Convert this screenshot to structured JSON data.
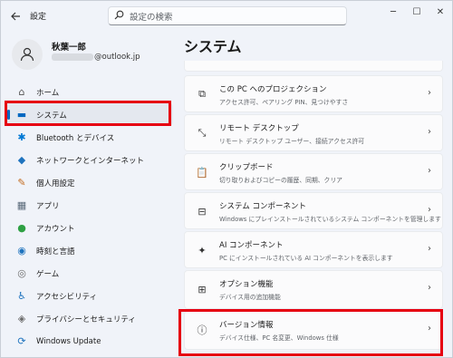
{
  "titlebar": {
    "back_icon": "back-arrow-icon",
    "app_title": "設定",
    "search_placeholder": "設定の検索",
    "minimize": "─",
    "maximize": "☐",
    "close": "✕"
  },
  "profile": {
    "name": "秋葉一郎",
    "email": "@outlook.jp"
  },
  "sidebar": {
    "items": [
      {
        "label": "ホーム",
        "icon": "home-icon",
        "glyph": "⌂",
        "color": "#555555"
      },
      {
        "label": "システム",
        "icon": "system-icon",
        "glyph": "▬",
        "color": "#0067c0"
      },
      {
        "label": "Bluetooth とデバイス",
        "icon": "bluetooth-icon",
        "glyph": "✱",
        "color": "#0078d4"
      },
      {
        "label": "ネットワークとインターネット",
        "icon": "wifi-icon",
        "glyph": "◆",
        "color": "#1e73be"
      },
      {
        "label": "個人用設定",
        "icon": "paintbrush-icon",
        "glyph": "✎",
        "color": "#c36b1e"
      },
      {
        "label": "アプリ",
        "icon": "apps-icon",
        "glyph": "▦",
        "color": "#5a6a7a"
      },
      {
        "label": "アカウント",
        "icon": "account-icon",
        "glyph": "●",
        "color": "#2ea043"
      },
      {
        "label": "時刻と言語",
        "icon": "globe-clock-icon",
        "glyph": "◉",
        "color": "#1e73be"
      },
      {
        "label": "ゲーム",
        "icon": "game-controller-icon",
        "glyph": "◎",
        "color": "#6b6b6b"
      },
      {
        "label": "アクセシビリティ",
        "icon": "accessibility-icon",
        "glyph": "♿",
        "color": "#1e73be"
      },
      {
        "label": "プライバシーとセキュリティ",
        "icon": "shield-icon",
        "glyph": "◈",
        "color": "#6b6b6b"
      },
      {
        "label": "Windows Update",
        "icon": "windows-update-icon",
        "glyph": "⟳",
        "color": "#1e73be"
      }
    ]
  },
  "main": {
    "title": "システム",
    "cards": [
      {
        "title": "この PC へのプロジェクション",
        "desc": "アクセス許可、ペアリング PIN、見つけやすさ",
        "icon": "projection-icon",
        "glyph": "⧉"
      },
      {
        "title": "リモート デスクトップ",
        "desc": "リモート デスクトップ ユーザー、接続アクセス許可",
        "icon": "remote-desktop-icon",
        "glyph": "⤡"
      },
      {
        "title": "クリップボード",
        "desc": "切り取りおよびコピーの履歴、同期、クリア",
        "icon": "clipboard-icon",
        "glyph": "📋"
      },
      {
        "title": "システム コンポーネント",
        "desc": "Windows にプレインストールされているシステム コンポーネントを管理します",
        "icon": "system-components-icon",
        "glyph": "⊟"
      },
      {
        "title": "AI コンポーネント",
        "desc": "PC にインストールされている AI コンポーネントを表示します",
        "icon": "ai-sparkle-icon",
        "glyph": "✦"
      },
      {
        "title": "オプション機能",
        "desc": "デバイス用の追加機能",
        "icon": "optional-features-icon",
        "glyph": "⊞"
      },
      {
        "title": "バージョン情報",
        "desc": "デバイス仕様、PC 名変更、Windows 仕様",
        "icon": "info-icon",
        "glyph": "ⓘ"
      }
    ]
  },
  "colors": {
    "accent": "#0067c0",
    "highlight_box": "#e60012",
    "window_bg": "#f0f3f9",
    "card_bg": "#fbfbfc"
  }
}
